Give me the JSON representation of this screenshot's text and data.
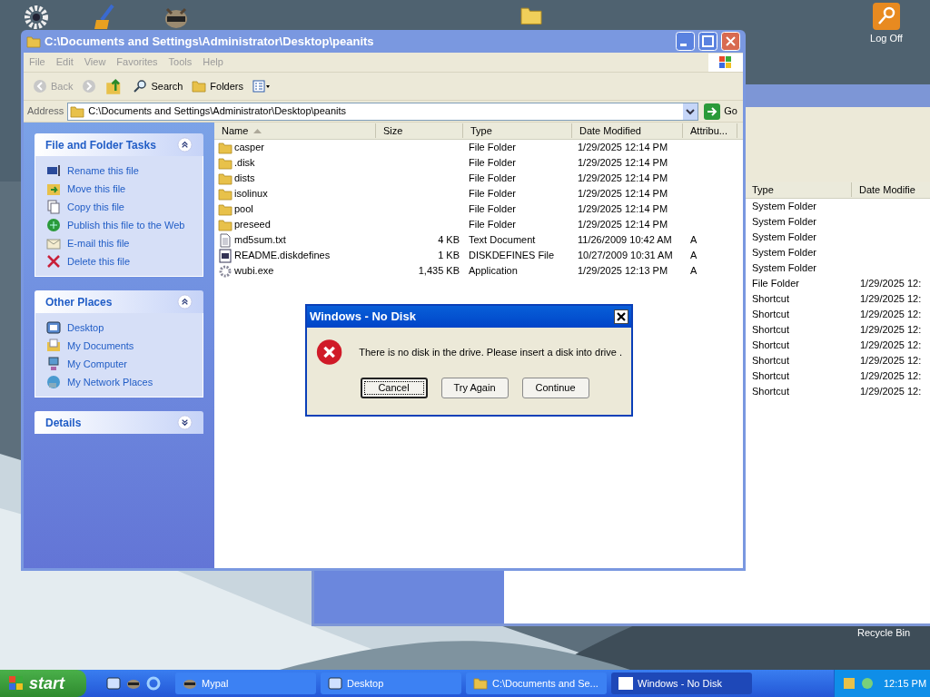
{
  "desktop_icons": [
    {
      "label": "Log Off"
    },
    {
      "label": "Recycle Bin"
    }
  ],
  "background_window": {
    "columns": [
      "Type",
      "Date Modifie"
    ],
    "rows": [
      {
        "type": "System Folder"
      },
      {
        "type": "System Folder"
      },
      {
        "type": "System Folder"
      },
      {
        "type": "System Folder"
      },
      {
        "type": "System Folder"
      },
      {
        "type": "File Folder",
        "modified": "1/29/2025 12:"
      },
      {
        "type": "Shortcut",
        "modified": "1/29/2025 12:"
      },
      {
        "type": "Shortcut",
        "modified": "1/29/2025 12:"
      },
      {
        "type": "Shortcut",
        "modified": "1/29/2025 12:"
      },
      {
        "type": "Shortcut",
        "modified": "1/29/2025 12:"
      },
      {
        "type": "Shortcut",
        "modified": "1/29/2025 12:"
      },
      {
        "type": "Shortcut",
        "modified": "1/29/2025 12:"
      },
      {
        "type": "Shortcut",
        "modified": "1/29/2025 12:"
      }
    ]
  },
  "explorer": {
    "title": "C:\\Documents and Settings\\Administrator\\Desktop\\peanits",
    "menu": [
      "File",
      "Edit",
      "View",
      "Favorites",
      "Tools",
      "Help"
    ],
    "toolbar": [
      {
        "kind": "back",
        "label": "Back",
        "disabled": true
      },
      {
        "kind": "forward",
        "disabled": true
      },
      {
        "kind": "up"
      },
      {
        "kind": "search",
        "label": "Search"
      },
      {
        "kind": "folders",
        "label": "Folders"
      },
      {
        "kind": "views"
      }
    ],
    "address_label": "Address",
    "address": "C:\\Documents and Settings\\Administrator\\Desktop\\peanits",
    "go": "Go",
    "task_sections": [
      {
        "title": "File and Folder Tasks",
        "expanded": true,
        "items": [
          {
            "kind": "rename",
            "label": "Rename this file"
          },
          {
            "kind": "move",
            "label": "Move this file"
          },
          {
            "kind": "copy",
            "label": "Copy this file"
          },
          {
            "kind": "publish",
            "label": "Publish this file to the Web"
          },
          {
            "kind": "email",
            "label": "E-mail this file"
          },
          {
            "kind": "delete",
            "label": "Delete this file"
          }
        ]
      },
      {
        "title": "Other Places",
        "expanded": true,
        "items": [
          {
            "kind": "desktop",
            "label": "Desktop"
          },
          {
            "kind": "documents",
            "label": "My Documents"
          },
          {
            "kind": "computer",
            "label": "My Computer"
          },
          {
            "kind": "network",
            "label": "My Network Places"
          }
        ]
      },
      {
        "title": "Details",
        "expanded": false
      }
    ],
    "columns": [
      "Name",
      "Size",
      "Type",
      "Date Modified",
      "Attribu..."
    ],
    "files": [
      {
        "kind": "folder",
        "name": "casper",
        "type": "File Folder",
        "modified": "1/29/2025 12:14 PM"
      },
      {
        "kind": "folder",
        "name": ".disk",
        "type": "File Folder",
        "modified": "1/29/2025 12:14 PM"
      },
      {
        "kind": "folder",
        "name": "dists",
        "type": "File Folder",
        "modified": "1/29/2025 12:14 PM"
      },
      {
        "kind": "folder",
        "name": "isolinux",
        "type": "File Folder",
        "modified": "1/29/2025 12:14 PM"
      },
      {
        "kind": "folder",
        "name": "pool",
        "type": "File Folder",
        "modified": "1/29/2025 12:14 PM"
      },
      {
        "kind": "folder",
        "name": "preseed",
        "type": "File Folder",
        "modified": "1/29/2025 12:14 PM"
      },
      {
        "kind": "text",
        "name": "md5sum.txt",
        "size": "4 KB",
        "type": "Text Document",
        "modified": "11/26/2009 10:42 AM",
        "attributes": "A"
      },
      {
        "kind": "file",
        "name": "README.diskdefines",
        "size": "1 KB",
        "type": "DISKDEFINES File",
        "modified": "10/27/2009 10:31 AM",
        "attributes": "A"
      },
      {
        "kind": "app",
        "name": "wubi.exe",
        "size": "1,435 KB",
        "type": "Application",
        "modified": "1/29/2025 12:13 PM",
        "attributes": "A"
      }
    ]
  },
  "dialog": {
    "title": "Windows - No Disk",
    "message": "There is no disk in the drive. Please insert a disk into drive .",
    "buttons": [
      {
        "label": "Cancel",
        "focused": true
      },
      {
        "label": "Try Again",
        "focused": false
      },
      {
        "label": "Continue",
        "focused": false
      }
    ]
  },
  "taskbar": {
    "start": "start",
    "tasks": [
      {
        "kind": "app",
        "label": "Mypal",
        "selected": false
      },
      {
        "kind": "desktop",
        "label": "Desktop",
        "selected": false
      },
      {
        "kind": "folder",
        "label": "C:\\Documents and Se...",
        "selected": false
      },
      {
        "kind": "window",
        "label": "Windows - No Disk",
        "selected": true
      }
    ],
    "clock": "12:15 PM"
  }
}
